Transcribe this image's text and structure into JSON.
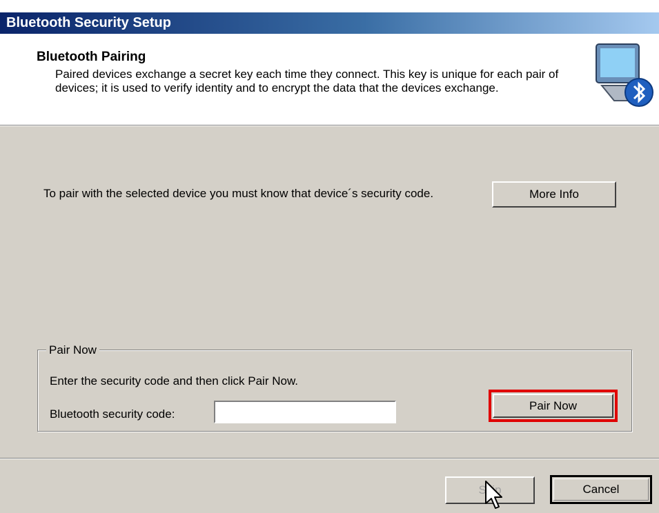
{
  "window": {
    "title": "Bluetooth Security Setup"
  },
  "header": {
    "title": "Bluetooth Pairing",
    "description": "Paired devices exchange a secret key each time they connect. This key is unique for each pair of devices; it is used to verify identity and to encrypt the data that the devices exchange.",
    "icon": "bluetooth-computer-icon"
  },
  "main": {
    "instruction": "To pair with the selected device you must know that device´s security code.",
    "more_info_label": "More Info"
  },
  "pair_now_group": {
    "legend": "Pair Now",
    "instruction": "Enter the security code and then click Pair Now.",
    "code_label": "Bluetooth security code:",
    "code_value": "",
    "code_placeholder": "",
    "pair_button_label": "Pair Now",
    "highlight_color": "#e00000"
  },
  "footer": {
    "skip_label": "Skip",
    "cancel_label": "Cancel"
  },
  "colors": {
    "titlebar_start": "#0a246a",
    "titlebar_end": "#a6caf0",
    "dialog_bg": "#d4d0c8"
  }
}
